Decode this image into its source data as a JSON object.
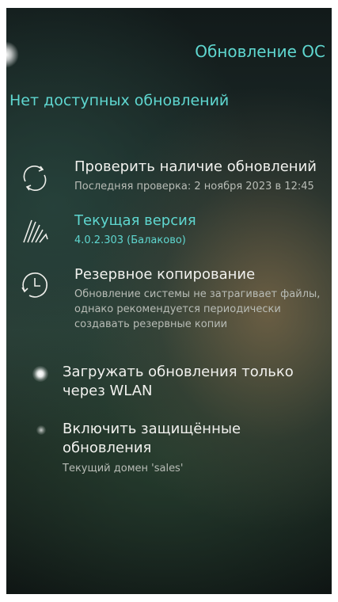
{
  "header": {
    "title": "Обновление ОС"
  },
  "status": {
    "text": "Нет доступных обновлений"
  },
  "items": [
    {
      "label": "Проверить наличие обновлений",
      "sub": "Последняя проверка: 2 ноября 2023 в 12:45",
      "icon": "refresh-icon"
    },
    {
      "label": "Текущая версия",
      "sub": "4.0.2.303 (Балаково)",
      "icon": "version-logo-icon"
    },
    {
      "label": "Резервное копирование",
      "sub": "Обновление системы не затрагивает файлы, однако рекомендуется периодически создавать резервные копии",
      "icon": "clock-backup-icon"
    }
  ],
  "toggles": [
    {
      "label": "Загружать обновления только через WLAN",
      "state": "on"
    },
    {
      "label": "Включить защищённые обновления",
      "sub": "Текущий домен 'sales'",
      "state": "off"
    }
  ],
  "colors": {
    "accent": "#5fd7d0",
    "text": "#f1f1ee",
    "secondary": "#b8bcb6"
  }
}
